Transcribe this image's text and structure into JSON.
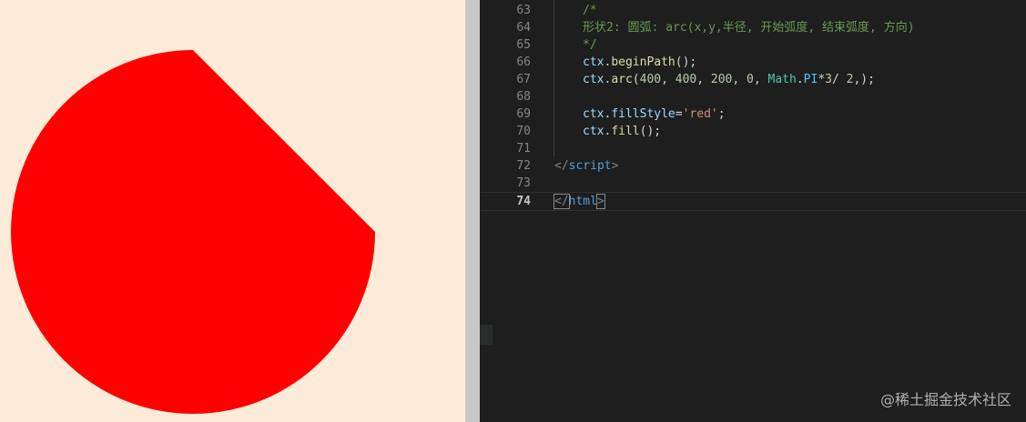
{
  "canvas": {
    "background": "#fbebd8",
    "shape": {
      "type": "arc",
      "fill": "#ff0000"
    }
  },
  "editor": {
    "lines": [
      {
        "num": "63",
        "tokens": [
          {
            "t": "comment",
            "v": "/*"
          }
        ]
      },
      {
        "num": "64",
        "tokens": [
          {
            "t": "comment",
            "v": "形状2: 圆弧: arc(x,y,半径, 开始弧度, 结束弧度, 方向)"
          }
        ]
      },
      {
        "num": "65",
        "tokens": [
          {
            "t": "comment",
            "v": "*/"
          }
        ]
      },
      {
        "num": "66",
        "tokens": [
          {
            "t": "var",
            "v": "ctx"
          },
          {
            "t": "punct",
            "v": "."
          },
          {
            "t": "fn",
            "v": "beginPath"
          },
          {
            "t": "punct",
            "v": "();"
          }
        ]
      },
      {
        "num": "67",
        "tokens": [
          {
            "t": "var",
            "v": "ctx"
          },
          {
            "t": "punct",
            "v": "."
          },
          {
            "t": "fn",
            "v": "arc"
          },
          {
            "t": "punct",
            "v": "("
          },
          {
            "t": "num",
            "v": "400"
          },
          {
            "t": "punct",
            "v": ", "
          },
          {
            "t": "num",
            "v": "400"
          },
          {
            "t": "punct",
            "v": ", "
          },
          {
            "t": "num",
            "v": "200"
          },
          {
            "t": "punct",
            "v": ", "
          },
          {
            "t": "num",
            "v": "0"
          },
          {
            "t": "punct",
            "v": ", "
          },
          {
            "t": "class",
            "v": "Math"
          },
          {
            "t": "punct",
            "v": "."
          },
          {
            "t": "const",
            "v": "PI"
          },
          {
            "t": "punct",
            "v": "*"
          },
          {
            "t": "num",
            "v": "3"
          },
          {
            "t": "punct",
            "v": "/ "
          },
          {
            "t": "num",
            "v": "2"
          },
          {
            "t": "punct",
            "v": ",);"
          }
        ]
      },
      {
        "num": "68",
        "tokens": []
      },
      {
        "num": "69",
        "tokens": [
          {
            "t": "var",
            "v": "ctx"
          },
          {
            "t": "punct",
            "v": "."
          },
          {
            "t": "var",
            "v": "fillStyle"
          },
          {
            "t": "punct",
            "v": "="
          },
          {
            "t": "str",
            "v": "'red'"
          },
          {
            "t": "punct",
            "v": ";"
          }
        ]
      },
      {
        "num": "70",
        "tokens": [
          {
            "t": "var",
            "v": "ctx"
          },
          {
            "t": "punct",
            "v": "."
          },
          {
            "t": "fn",
            "v": "fill"
          },
          {
            "t": "punct",
            "v": "();"
          }
        ]
      },
      {
        "num": "71",
        "tokens": []
      },
      {
        "num": "72",
        "tokens": [
          {
            "t": "tagpunct",
            "v": "</"
          },
          {
            "t": "tag",
            "v": "script"
          },
          {
            "t": "tagpunct",
            "v": ">"
          }
        ]
      },
      {
        "num": "73",
        "tokens": []
      },
      {
        "num": "74",
        "current": true,
        "tokens": [
          {
            "t": "tagpunct",
            "v": "</",
            "match": true
          },
          {
            "t": "tag",
            "v": "html"
          },
          {
            "t": "tagpunct",
            "v": ">",
            "match": true
          }
        ]
      }
    ],
    "indented_lines": [
      "63",
      "64",
      "65",
      "66",
      "67",
      "68",
      "69",
      "70",
      "71"
    ]
  },
  "watermark": "@稀土掘金技术社区",
  "colors": {
    "editor_bg": "#1e1e1e",
    "comment": "#6a9955",
    "variable": "#9cdcfe",
    "function": "#dcdcaa",
    "number": "#b5cea8",
    "class": "#4ec9b0",
    "constant": "#4fc1ff",
    "string": "#ce9178",
    "tag": "#569cd6"
  }
}
